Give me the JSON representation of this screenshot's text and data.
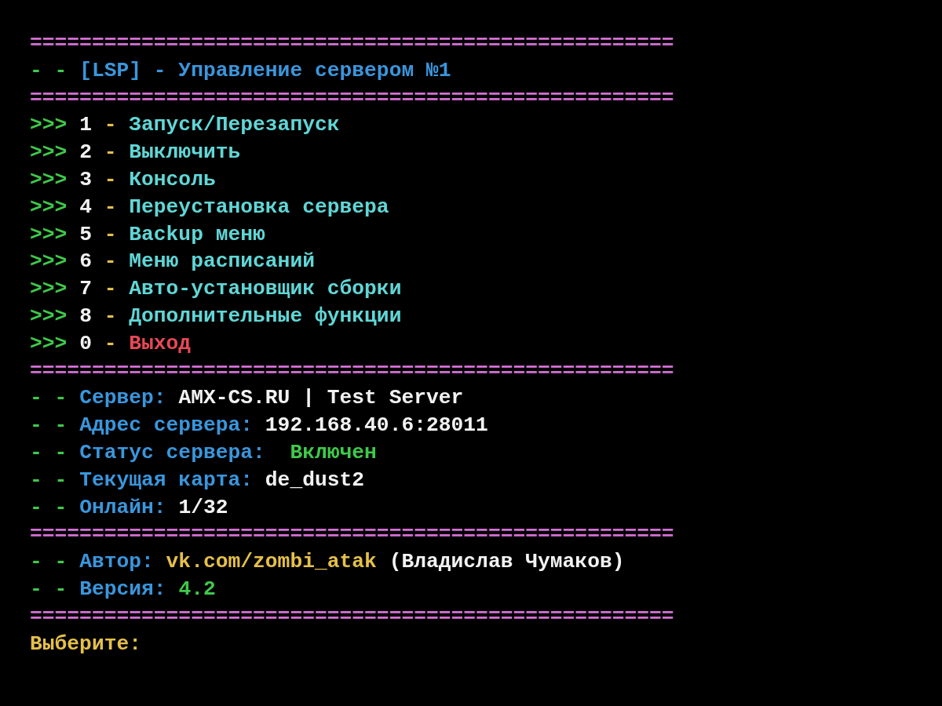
{
  "lines": [
    {
      "kind": "rule",
      "text": "====================================================",
      "color": "#d670d6"
    },
    {
      "kind": "text",
      "segments": [
        {
          "text": "- -",
          "color": "#3fc94a"
        },
        {
          "text": "[LSP] - Управление сервером №1",
          "color": "#3a96dd"
        }
      ]
    },
    {
      "kind": "rule",
      "text": "====================================================",
      "color": "#d670d6"
    },
    {
      "kind": "text",
      "segments": [
        {
          "text": ">>>",
          "color": "#3fc94a"
        },
        {
          "text": "1",
          "color": "#f2f2f2"
        },
        {
          "text": "-",
          "color": "#e5c04a"
        },
        {
          "text": "Запуск/Перезапуск",
          "color": "#61d6d6"
        }
      ]
    },
    {
      "kind": "text",
      "segments": [
        {
          "text": ">>>",
          "color": "#3fc94a"
        },
        {
          "text": "2",
          "color": "#f2f2f2"
        },
        {
          "text": "-",
          "color": "#e5c04a"
        },
        {
          "text": "Выключить",
          "color": "#61d6d6"
        }
      ]
    },
    {
      "kind": "text",
      "segments": [
        {
          "text": ">>>",
          "color": "#3fc94a"
        },
        {
          "text": "3",
          "color": "#f2f2f2"
        },
        {
          "text": "-",
          "color": "#e5c04a"
        },
        {
          "text": "Консоль",
          "color": "#61d6d6"
        }
      ]
    },
    {
      "kind": "text",
      "segments": [
        {
          "text": ">>>",
          "color": "#3fc94a"
        },
        {
          "text": "4",
          "color": "#f2f2f2"
        },
        {
          "text": "-",
          "color": "#e5c04a"
        },
        {
          "text": "Переустановка сервера",
          "color": "#61d6d6"
        }
      ]
    },
    {
      "kind": "text",
      "segments": [
        {
          "text": ">>>",
          "color": "#3fc94a"
        },
        {
          "text": "5",
          "color": "#f2f2f2"
        },
        {
          "text": "-",
          "color": "#e5c04a"
        },
        {
          "text": "Backup меню",
          "color": "#61d6d6"
        }
      ]
    },
    {
      "kind": "text",
      "segments": [
        {
          "text": ">>>",
          "color": "#3fc94a"
        },
        {
          "text": "6",
          "color": "#f2f2f2"
        },
        {
          "text": "-",
          "color": "#e5c04a"
        },
        {
          "text": "Меню расписаний",
          "color": "#61d6d6"
        }
      ]
    },
    {
      "kind": "text",
      "segments": [
        {
          "text": ">>>",
          "color": "#3fc94a"
        },
        {
          "text": "7",
          "color": "#f2f2f2"
        },
        {
          "text": "-",
          "color": "#e5c04a"
        },
        {
          "text": "Авто-установщик сборки",
          "color": "#61d6d6"
        }
      ]
    },
    {
      "kind": "text",
      "segments": [
        {
          "text": ">>>",
          "color": "#3fc94a"
        },
        {
          "text": "8",
          "color": "#f2f2f2"
        },
        {
          "text": "-",
          "color": "#e5c04a"
        },
        {
          "text": "Дополнительные функции",
          "color": "#61d6d6"
        }
      ]
    },
    {
      "kind": "text",
      "segments": [
        {
          "text": ">>>",
          "color": "#3fc94a"
        },
        {
          "text": "0",
          "color": "#f2f2f2"
        },
        {
          "text": "-",
          "color": "#e5c04a"
        },
        {
          "text": "Выход",
          "color": "#e74856"
        }
      ]
    },
    {
      "kind": "rule",
      "text": "====================================================",
      "color": "#d670d6"
    },
    {
      "kind": "text",
      "segments": [
        {
          "text": "- -",
          "color": "#3fc94a"
        },
        {
          "text": "Сервер:",
          "color": "#3a96dd"
        },
        {
          "text": "AMX-CS.RU | Test Server",
          "color": "#f2f2f2"
        }
      ]
    },
    {
      "kind": "text",
      "segments": [
        {
          "text": "- -",
          "color": "#3fc94a"
        },
        {
          "text": "Адрес сервера:",
          "color": "#3a96dd"
        },
        {
          "text": "192.168.40.6:28011",
          "color": "#f2f2f2"
        }
      ]
    },
    {
      "kind": "text",
      "segments": [
        {
          "text": "- -",
          "color": "#3fc94a"
        },
        {
          "text": "Статус сервера: ",
          "color": "#3a96dd"
        },
        {
          "text": "Включен",
          "color": "#3fc94a"
        }
      ]
    },
    {
      "kind": "text",
      "segments": [
        {
          "text": "- -",
          "color": "#3fc94a"
        },
        {
          "text": "Текущая карта:",
          "color": "#3a96dd"
        },
        {
          "text": "de_dust2",
          "color": "#f2f2f2"
        }
      ]
    },
    {
      "kind": "text",
      "segments": [
        {
          "text": "- -",
          "color": "#3fc94a"
        },
        {
          "text": "Онлайн:",
          "color": "#3a96dd"
        },
        {
          "text": "1/32",
          "color": "#f2f2f2"
        }
      ]
    },
    {
      "kind": "rule",
      "text": "====================================================",
      "color": "#d670d6"
    },
    {
      "kind": "text",
      "segments": [
        {
          "text": "- -",
          "color": "#3fc94a"
        },
        {
          "text": "Автор:",
          "color": "#3a96dd"
        },
        {
          "text": "vk.com/zombi_atak",
          "color": "#e5c04a"
        },
        {
          "text": "(Владислав Чумаков)",
          "color": "#f2f2f2"
        }
      ]
    },
    {
      "kind": "text",
      "segments": [
        {
          "text": "- -",
          "color": "#3fc94a"
        },
        {
          "text": "Версия:",
          "color": "#3a96dd"
        },
        {
          "text": "4.2",
          "color": "#3fc94a"
        }
      ]
    },
    {
      "kind": "rule",
      "text": "====================================================",
      "color": "#d670d6"
    },
    {
      "kind": "text",
      "segments": [
        {
          "text": "Выберите:",
          "color": "#e5c04a"
        }
      ]
    }
  ]
}
